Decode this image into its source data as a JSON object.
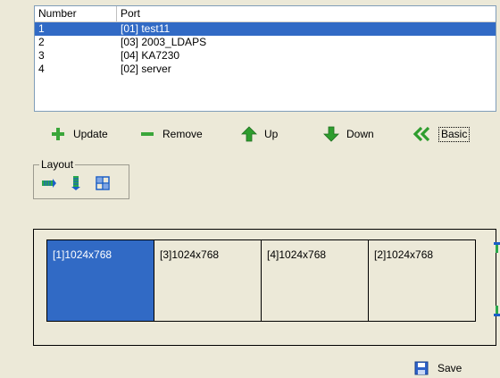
{
  "list": {
    "columns": [
      "Number",
      "Port"
    ],
    "rows": [
      {
        "number": "1",
        "port": "[01] test11",
        "selected": true
      },
      {
        "number": "2",
        "port": "[03] 2003_LDAPS",
        "selected": false
      },
      {
        "number": "3",
        "port": "[04] KA7230",
        "selected": false
      },
      {
        "number": "4",
        "port": "[02] server",
        "selected": false
      }
    ]
  },
  "toolbar": {
    "update_label": "Update",
    "update_icon": "plus-icon",
    "remove_label": "Remove",
    "remove_icon": "minus-icon",
    "up_label": "Up",
    "up_icon": "arrow-up-icon",
    "down_label": "Down",
    "down_icon": "arrow-down-icon",
    "basic_label": "Basic",
    "basic_icon": "double-chevron-left-icon"
  },
  "layout": {
    "legend": "Layout",
    "options": [
      "horizontal-layout-icon",
      "vertical-layout-icon",
      "grid-layout-icon"
    ]
  },
  "screens": [
    {
      "label": "[1]1024x768",
      "active": true
    },
    {
      "label": "[3]1024x768",
      "active": false
    },
    {
      "label": "[4]1024x768",
      "active": false
    },
    {
      "label": "[2]1024x768",
      "active": false
    }
  ],
  "save": {
    "label": "Save",
    "icon": "floppy-disk-icon"
  },
  "colors": {
    "selection": "#316ac5",
    "window_bg": "#ece9d8",
    "plus_green": "#3aa63a",
    "arrow_green": "#2e9d2e"
  }
}
